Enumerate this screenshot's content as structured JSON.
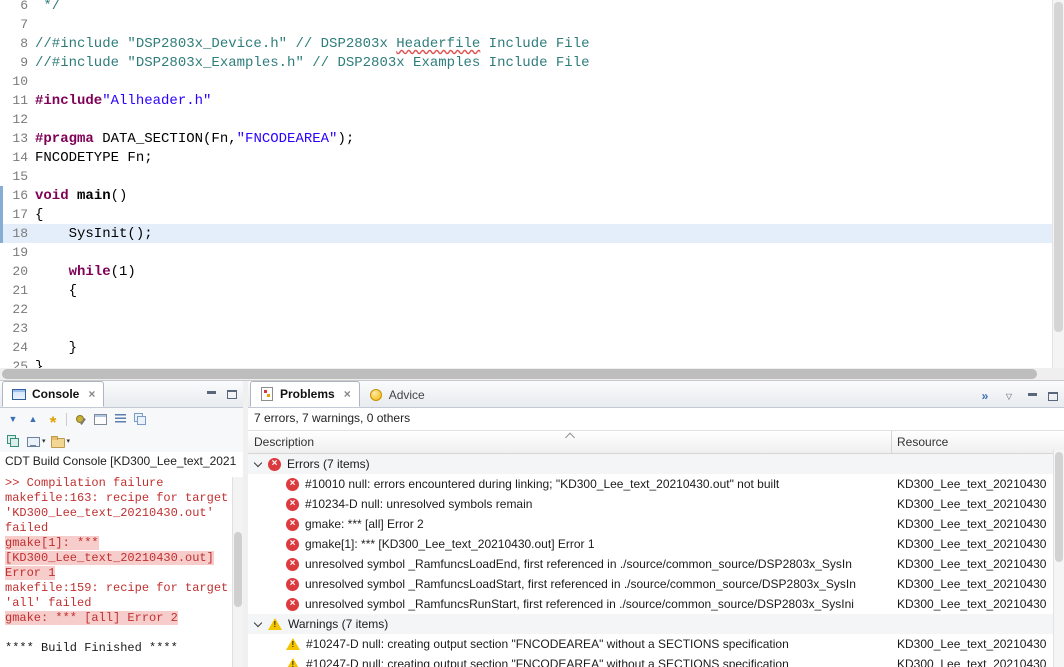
{
  "palette": {
    "keyword": "#7F0055",
    "string": "#2A00FF",
    "comment": "#2E7D7B",
    "console_error_text": "#C03030",
    "console_error_highlight": "#F6CDCB",
    "current_line_highlight": "#E4EEFA",
    "error_icon": "#DB3A3F",
    "warning_icon": "#F2C500"
  },
  "glyphs": {
    "close": "×",
    "dropdown_caret": "▾"
  },
  "editor": {
    "current_line": 18,
    "lines": [
      {
        "n": 6,
        "seg": [
          [
            "c",
            " */"
          ]
        ]
      },
      {
        "n": 7,
        "seg": []
      },
      {
        "n": 8,
        "seg": [
          [
            "c",
            "//#include \"DSP2803x_Device.h\" // DSP2803x "
          ],
          [
            "cm",
            "Headerfile"
          ],
          [
            "c",
            " Include File"
          ]
        ]
      },
      {
        "n": 9,
        "seg": [
          [
            "c",
            "//#include \"DSP2803x_Examples.h\" // DSP2803x Examples Include File"
          ]
        ]
      },
      {
        "n": 10,
        "seg": []
      },
      {
        "n": 11,
        "seg": [
          [
            "k",
            "#include"
          ],
          [
            "s",
            "\"Allheader.h\""
          ]
        ]
      },
      {
        "n": 12,
        "seg": []
      },
      {
        "n": 13,
        "seg": [
          [
            "k",
            "#pragma"
          ],
          [
            "p",
            " DATA_SECTION(Fn,"
          ],
          [
            "s",
            "\"FNCODEAREA\""
          ],
          [
            "p",
            ");"
          ]
        ]
      },
      {
        "n": 14,
        "seg": [
          [
            "p",
            "FNCODETYPE Fn;"
          ]
        ]
      },
      {
        "n": 15,
        "seg": []
      },
      {
        "n": 16,
        "seg": [
          [
            "k",
            "void"
          ],
          [
            "p",
            " "
          ],
          [
            "b",
            "main"
          ],
          [
            "p",
            "()"
          ]
        ]
      },
      {
        "n": 17,
        "seg": [
          [
            "p",
            "{"
          ]
        ]
      },
      {
        "n": 18,
        "seg": [
          [
            "p",
            "    SysInit();"
          ]
        ]
      },
      {
        "n": 19,
        "seg": []
      },
      {
        "n": 20,
        "seg": [
          [
            "p",
            "    "
          ],
          [
            "k",
            "while"
          ],
          [
            "p",
            "(1)"
          ]
        ]
      },
      {
        "n": 21,
        "seg": [
          [
            "p",
            "    {"
          ]
        ]
      },
      {
        "n": 22,
        "seg": []
      },
      {
        "n": 23,
        "seg": []
      },
      {
        "n": 24,
        "seg": [
          [
            "p",
            "    }"
          ]
        ]
      },
      {
        "n": 25,
        "seg": [
          [
            "p",
            "}"
          ]
        ]
      }
    ]
  },
  "console": {
    "tab_label": "Console",
    "title": "CDT Build Console [KD300_Lee_text_2021",
    "toolbar_row1": [
      {
        "name": "scroll-down-icon"
      },
      {
        "name": "scroll-up-icon"
      },
      {
        "name": "show-console-on-output-icon"
      },
      {
        "name": "separator"
      },
      {
        "name": "pin-console-icon"
      },
      {
        "name": "display-selected-console-icon"
      },
      {
        "name": "word-wrap-icon"
      },
      {
        "name": "clear-console-icon"
      }
    ],
    "toolbar_row2": [
      {
        "name": "new-console-view-icon"
      },
      {
        "name": "display-console-icon",
        "caret": true
      },
      {
        "name": "open-console-icon",
        "caret": true
      }
    ],
    "lines": [
      {
        "text": ">> Compilation failure",
        "style": "err"
      },
      {
        "text": "makefile:163: recipe for target",
        "style": "err"
      },
      {
        "text": "'KD300_Lee_text_20210430.out'",
        "style": "err"
      },
      {
        "text": "failed",
        "style": "err"
      },
      {
        "text": "gmake[1]: ***",
        "style": "err",
        "highlight": true
      },
      {
        "text": "[KD300_Lee_text_20210430.out]",
        "style": "err",
        "highlight": true
      },
      {
        "text": "Error 1",
        "style": "err",
        "highlight": true
      },
      {
        "text": "makefile:159: recipe for target",
        "style": "err"
      },
      {
        "text": "'all' failed",
        "style": "err"
      },
      {
        "text": "gmake: *** [all] Error 2",
        "style": "err",
        "highlight": true
      },
      {
        "text": "",
        "style": "plain"
      },
      {
        "text": "**** Build Finished ****",
        "style": "plain"
      }
    ]
  },
  "problems": {
    "tab_label": "Problems",
    "advice_tab_label": "Advice",
    "summary": "7 errors, 7 warnings, 0 others",
    "columns": [
      "Description",
      "Resource"
    ],
    "toolbar": [
      {
        "name": "double-arrow-icon"
      },
      {
        "name": "view-menu-icon"
      }
    ],
    "groups": [
      {
        "label": "Errors (7 items)",
        "kind": "error",
        "items": [
          {
            "description": "#10010 null: errors encountered during linking; \"KD300_Lee_text_20210430.out\" not built",
            "resource": "KD300_Lee_text_20210430"
          },
          {
            "description": "#10234-D null: unresolved symbols remain",
            "resource": "KD300_Lee_text_20210430"
          },
          {
            "description": "gmake: *** [all] Error 2",
            "resource": "KD300_Lee_text_20210430"
          },
          {
            "description": "gmake[1]: *** [KD300_Lee_text_20210430.out] Error 1",
            "resource": "KD300_Lee_text_20210430"
          },
          {
            "description": "unresolved symbol _RamfuncsLoadEnd, first referenced in ./source/common_source/DSP2803x_SysIn",
            "resource": "KD300_Lee_text_20210430"
          },
          {
            "description": "unresolved symbol _RamfuncsLoadStart, first referenced in ./source/common_source/DSP2803x_SysIn",
            "resource": "KD300_Lee_text_20210430"
          },
          {
            "description": "unresolved symbol _RamfuncsRunStart, first referenced in ./source/common_source/DSP2803x_SysIni",
            "resource": "KD300_Lee_text_20210430"
          }
        ]
      },
      {
        "label": "Warnings (7 items)",
        "kind": "warning",
        "items": [
          {
            "description": "#10247-D null: creating output section \"FNCODEAREA\" without a SECTIONS specification",
            "resource": "KD300_Lee_text_20210430"
          },
          {
            "description": "#10247-D null: creating output section \"FNCODEAREA\" without a SECTIONS specification",
            "resource": "KD300_Lee_text_20210430"
          }
        ]
      }
    ]
  }
}
